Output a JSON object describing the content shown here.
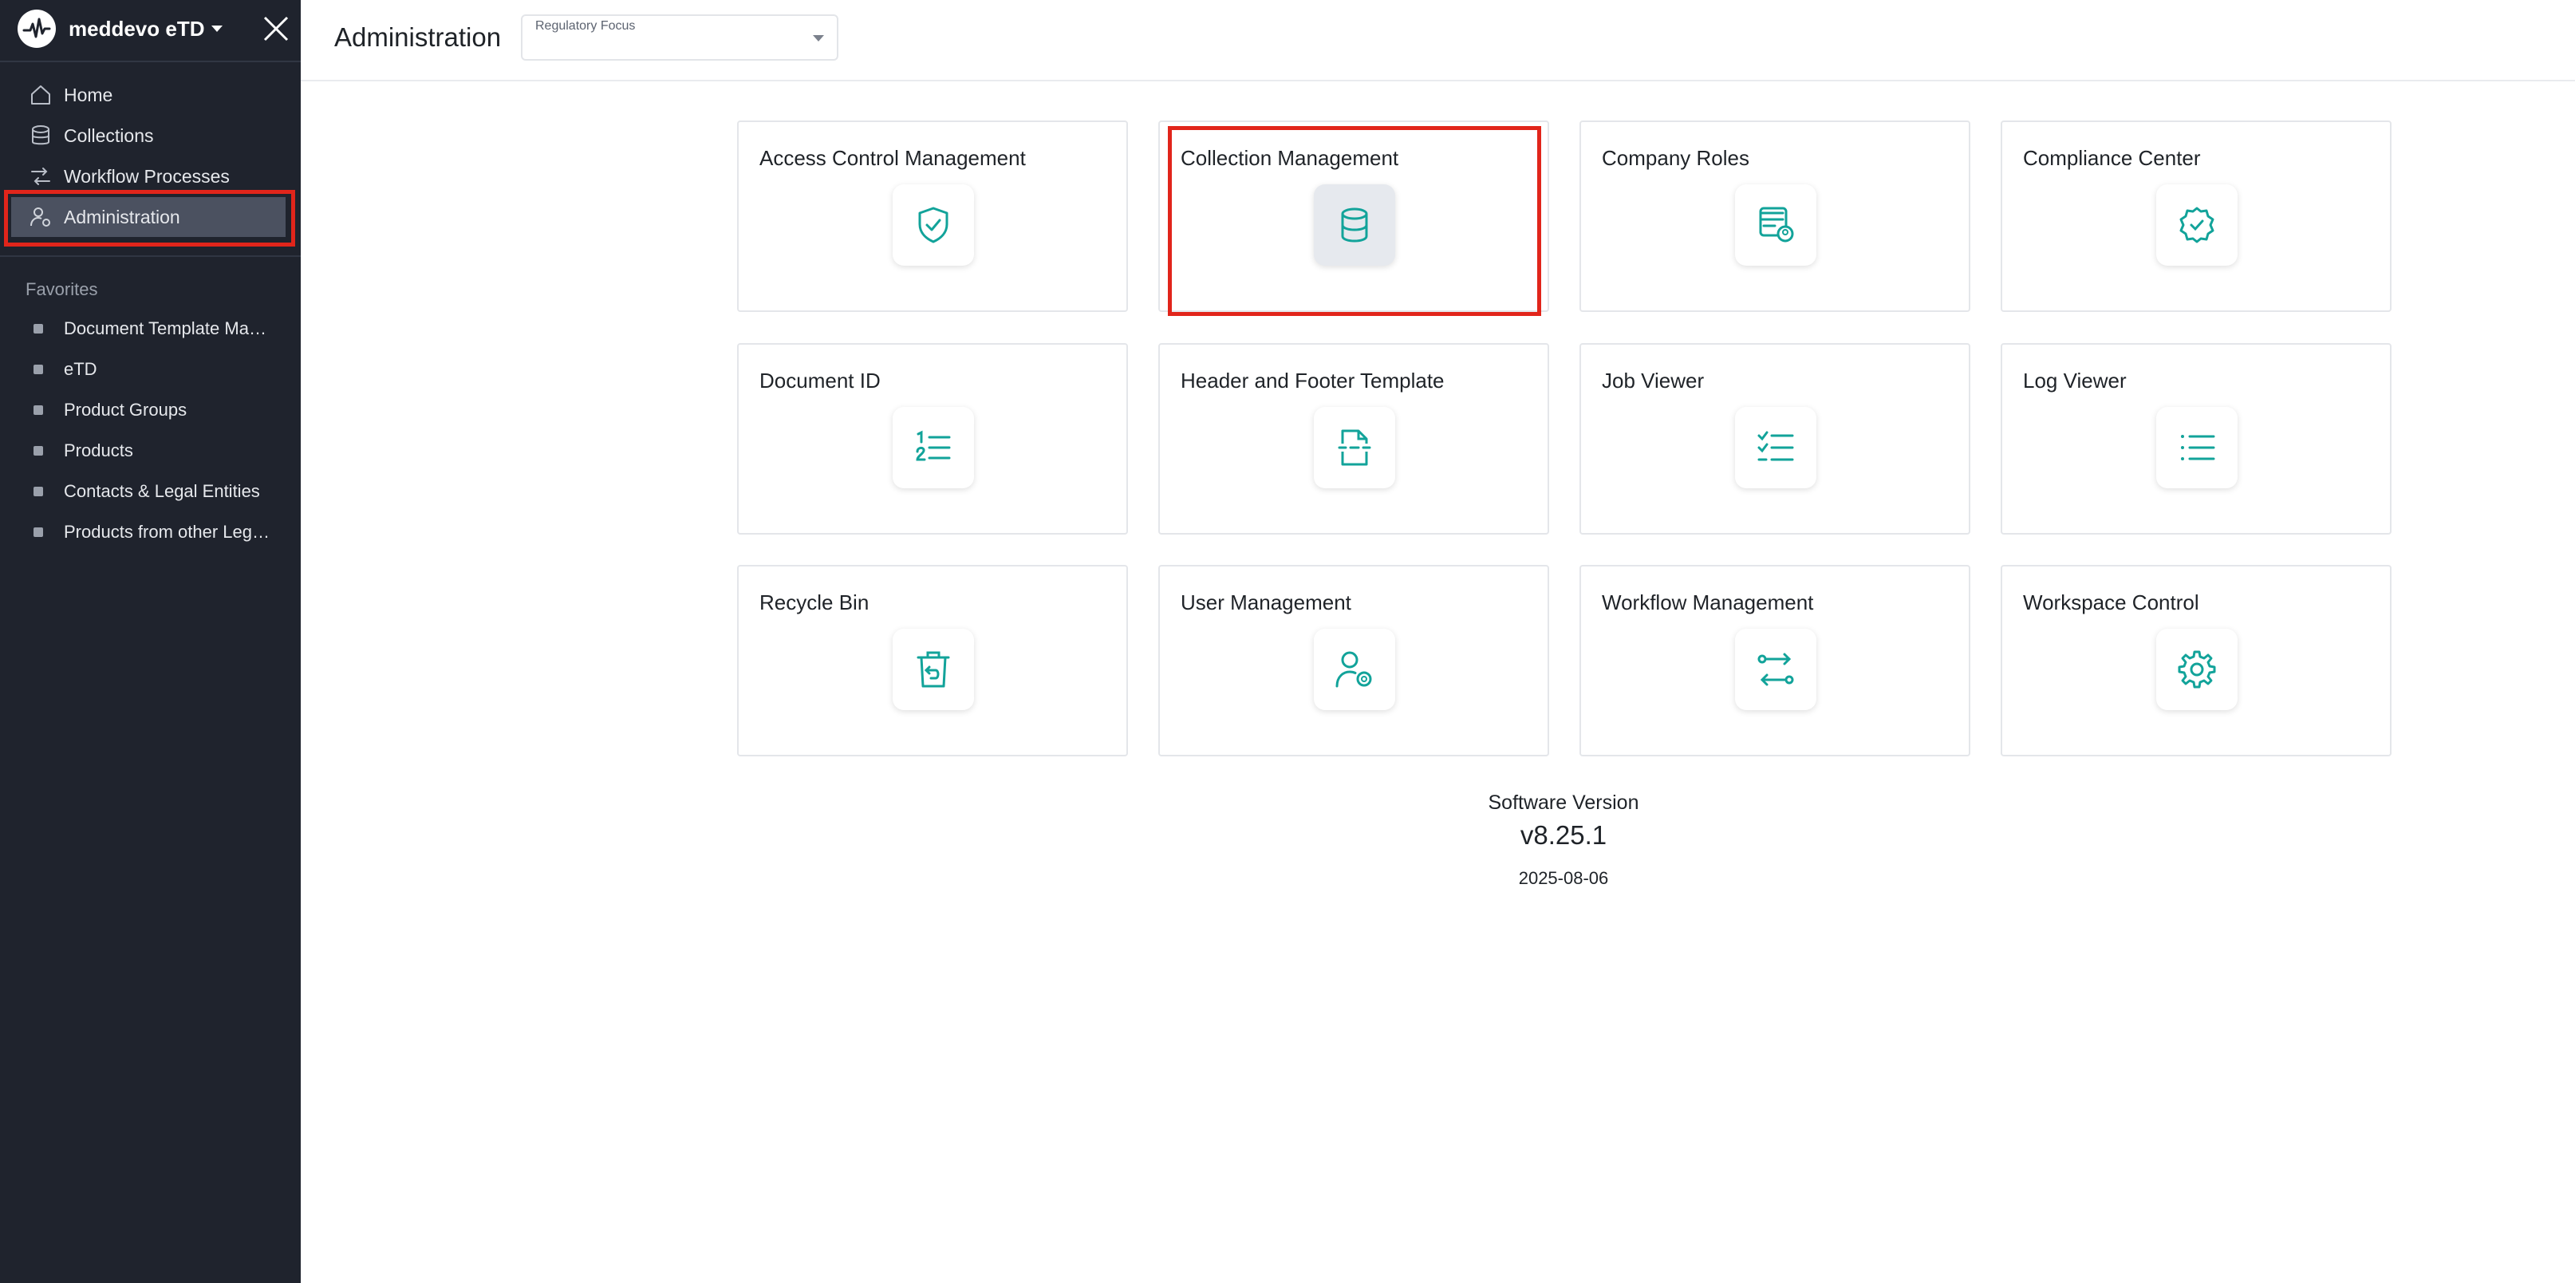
{
  "app": {
    "name": "meddevo eTD"
  },
  "sidebar": {
    "nav": [
      {
        "label": "Home",
        "icon": "home-icon"
      },
      {
        "label": "Collections",
        "icon": "database-icon"
      },
      {
        "label": "Workflow Processes",
        "icon": "workflow-icon"
      },
      {
        "label": "Administration",
        "icon": "user-settings-icon",
        "active": true
      }
    ],
    "favorites_title": "Favorites",
    "favorites": [
      "Document Template Management",
      "eTD",
      "Product Groups",
      "Products",
      "Contacts & Legal Entities",
      "Products from other Legal Entities"
    ]
  },
  "header": {
    "title": "Administration",
    "regulatory_focus": {
      "label": "Regulatory Focus",
      "value": ""
    }
  },
  "cards": [
    {
      "title": "Access Control Management",
      "icon": "shield-check-icon"
    },
    {
      "title": "Collection Management",
      "icon": "database-icon",
      "selected": true
    },
    {
      "title": "Company Roles",
      "icon": "roles-icon"
    },
    {
      "title": "Compliance Center",
      "icon": "badge-check-icon"
    },
    {
      "title": "Document ID",
      "icon": "numbered-list-icon"
    },
    {
      "title": "Header and Footer Template",
      "icon": "file-template-icon"
    },
    {
      "title": "Job Viewer",
      "icon": "checklist-icon"
    },
    {
      "title": "Log Viewer",
      "icon": "list-icon"
    },
    {
      "title": "Recycle Bin",
      "icon": "trash-restore-icon"
    },
    {
      "title": "User Management",
      "icon": "user-settings-icon"
    },
    {
      "title": "Workflow Management",
      "icon": "workflow-icon"
    },
    {
      "title": "Workspace Control",
      "icon": "gear-icon"
    }
  ],
  "version": {
    "label": "Software Version",
    "number": "v8.25.1",
    "date": "2025-08-06"
  },
  "colors": {
    "sidebar_bg": "#1f232d",
    "accent_teal": "#12a39a",
    "highlight_red": "#e1251b"
  }
}
